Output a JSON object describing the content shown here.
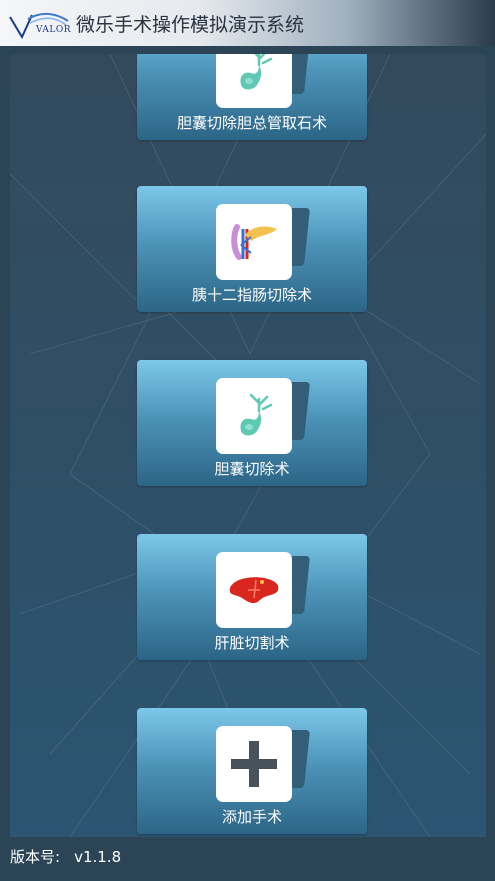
{
  "header": {
    "logo_text": "VALOR",
    "title": "微乐手术操作模拟演示系统"
  },
  "surgeries": [
    {
      "label": "胆囊切除胆总管取石术",
      "icon": "gallbladder-icon"
    },
    {
      "label": "胰十二指肠切除术",
      "icon": "pancreas-icon"
    },
    {
      "label": "胆囊切除术",
      "icon": "gallbladder-icon"
    },
    {
      "label": "肝脏切割术",
      "icon": "liver-icon"
    },
    {
      "label": "添加手术",
      "icon": "plus-icon"
    }
  ],
  "footer": {
    "version_label": "版本号:",
    "version_value": "v1.1.8"
  },
  "colors": {
    "card_top": "#7cc7ea",
    "card_bottom": "#2c6586",
    "gallbladder": "#5fc9b4",
    "liver": "#d8281e",
    "plus": "#48525a"
  }
}
